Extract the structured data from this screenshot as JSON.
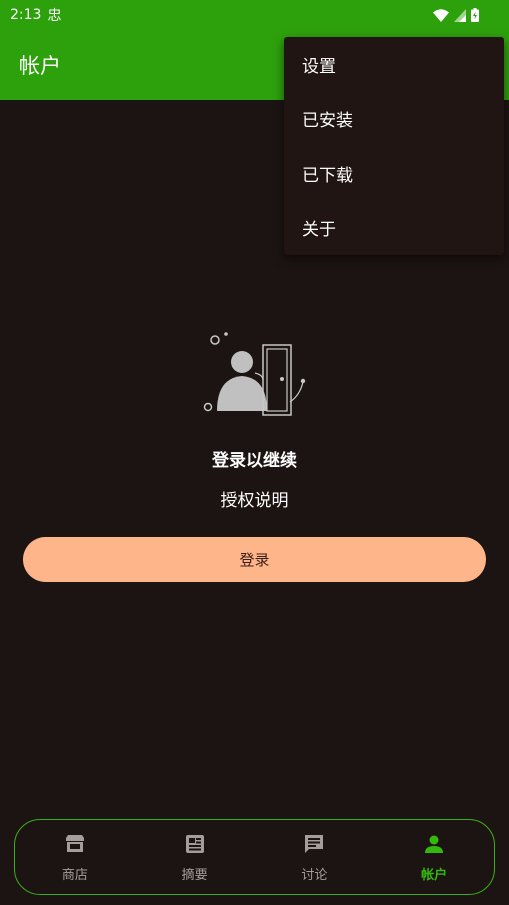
{
  "status_bar": {
    "time": "2:13",
    "notification_glyph": "忠"
  },
  "app_bar": {
    "title": "帐户"
  },
  "menu": {
    "items": [
      "设置",
      "已安装",
      "已下载",
      "关于"
    ]
  },
  "login": {
    "title": "登录以继续",
    "description": "授权说明",
    "button_label": "登录"
  },
  "bottom_nav": {
    "items": [
      {
        "label": "商店",
        "icon": "store-icon"
      },
      {
        "label": "摘要",
        "icon": "article-icon"
      },
      {
        "label": "讨论",
        "icon": "chat-icon"
      },
      {
        "label": "帐户",
        "icon": "person-icon"
      }
    ],
    "active_index": 3
  },
  "colors": {
    "accent_green": "#2da10c",
    "background": "#1c1412",
    "button_peach": "#ffb58a",
    "active_nav": "#34b80e"
  }
}
